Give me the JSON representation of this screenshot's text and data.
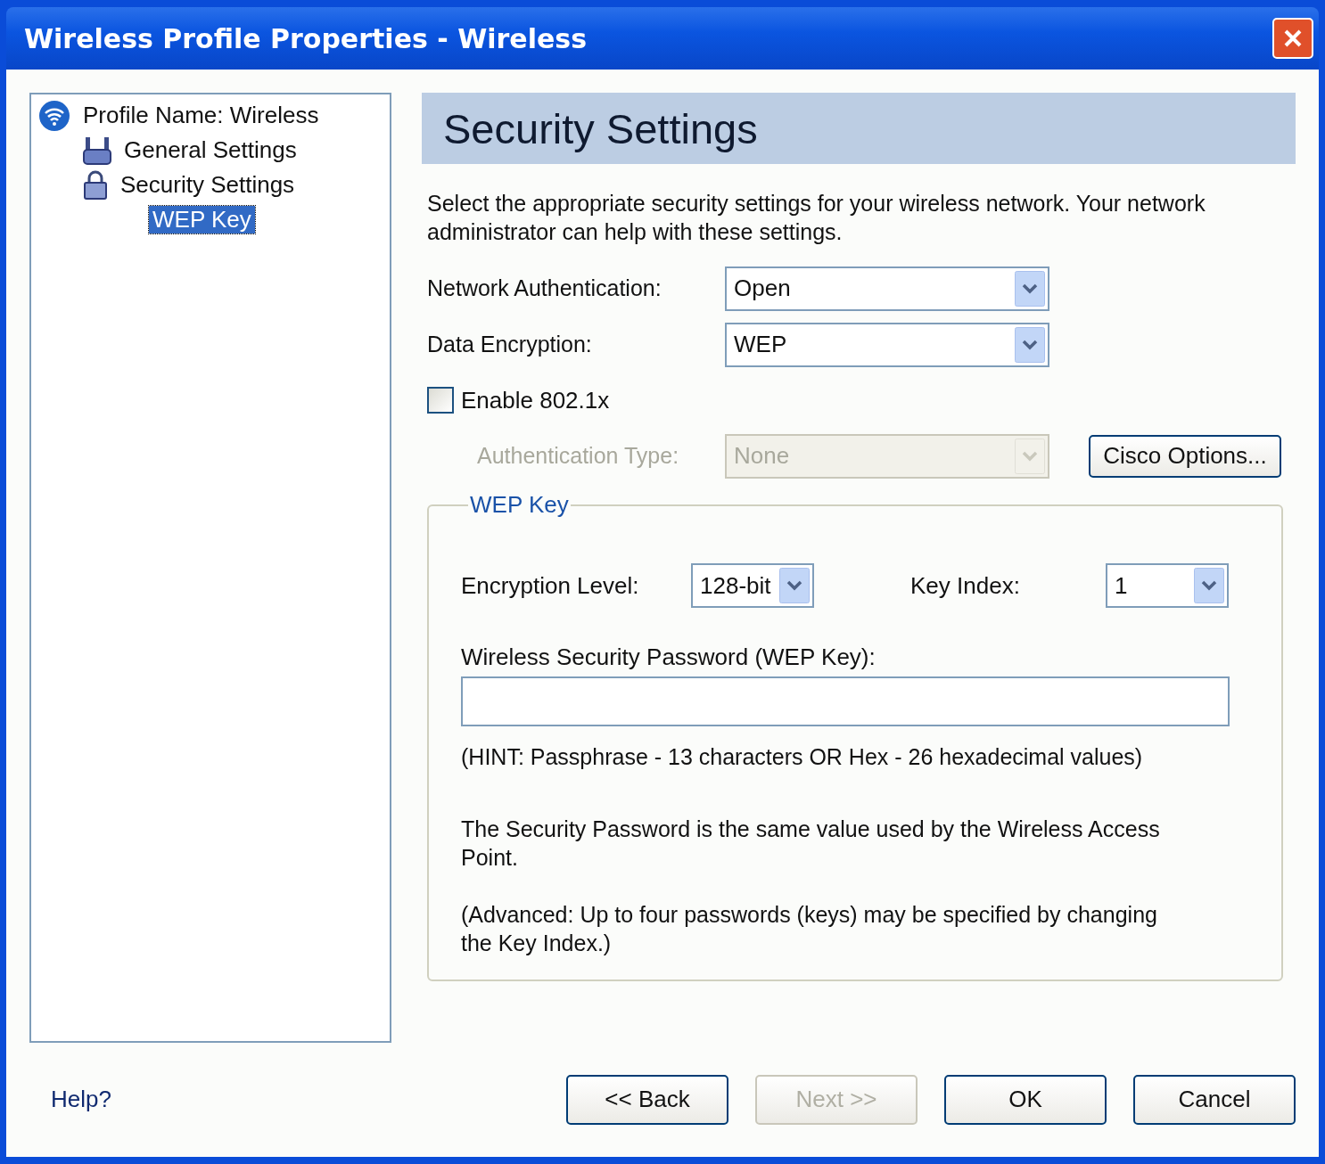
{
  "window": {
    "title": "Wireless Profile Properties - Wireless"
  },
  "tree": [
    {
      "label": "Profile Name: Wireless",
      "kind": "network",
      "selected": false,
      "children": [
        {
          "label": "General Settings",
          "kind": "adapter",
          "selected": false
        },
        {
          "label": "Security Settings",
          "kind": "lock",
          "selected": false,
          "children": [
            {
              "label": "WEP Key",
              "kind": "none",
              "selected": true
            }
          ]
        }
      ]
    }
  ],
  "header": {
    "title": "Security Settings"
  },
  "description": "Select the appropriate security settings for your wireless network. Your network administrator can help with these settings.",
  "settings": [
    {
      "label": "Network Authentication:",
      "value": "Open"
    },
    {
      "label": "Data Encryption:",
      "value": "WEP"
    }
  ],
  "enable_8021x": {
    "label": "Enable 802.1x",
    "checked": false
  },
  "auth_type": {
    "label": "Authentication Type:",
    "value": "None",
    "disabled": true
  },
  "cisco_button": {
    "label": "Cisco Options..."
  },
  "wep_group": {
    "title": "WEP Key",
    "encryption_level": {
      "label": "Encryption Level:",
      "value": "128-bit"
    },
    "key_index": {
      "label": "Key Index:",
      "value": "1"
    },
    "password": {
      "label": "Wireless Security Password (WEP Key):"
    },
    "hint": "(HINT: Passphrase - 13 characters OR Hex - 26 hexadecimal values)",
    "notes": [
      "The Security Password is the same value used by the Wireless Access Point.",
      "(Advanced: Up to four passwords (keys) may be specified by changing the Key Index.)"
    ]
  },
  "footer": {
    "help": "Help?",
    "buttons": [
      {
        "label": "<< Back",
        "disabled": false
      },
      {
        "label": "Next >>",
        "disabled": true
      },
      {
        "label": "OK",
        "disabled": false
      },
      {
        "label": "Cancel",
        "disabled": false
      }
    ]
  }
}
